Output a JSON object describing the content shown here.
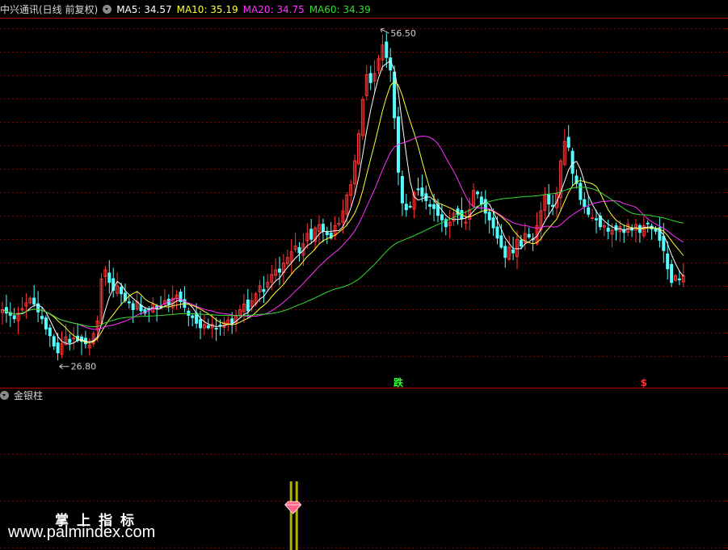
{
  "header": {
    "stock_name": "中兴通讯(日线 前复权)",
    "ma_labels": [
      {
        "text": "MA5: 34.57",
        "color": "#ffffff"
      },
      {
        "text": "MA10: 35.19",
        "color": "#ffff33"
      },
      {
        "text": "MA20: 34.75",
        "color": "#ff33ff"
      },
      {
        "text": "MA60: 34.39",
        "color": "#33dd33"
      }
    ]
  },
  "indicator": {
    "name": "金银柱"
  },
  "colors": {
    "up": "#ff3333",
    "down": "#54ffff",
    "grid": "#7a0000",
    "ma5": "#ffffff",
    "ma10": "#ffff33",
    "ma20": "#ff33ff",
    "ma60": "#33dd33"
  },
  "chart_data": {
    "type": "candlestick",
    "y_range": [
      25.5,
      57.5
    ],
    "max_label": "56.50",
    "min_label": "26.80",
    "max_value": 56.5,
    "min_value": 26.8,
    "signals": [
      {
        "label": "跌",
        "color": "#33ff33",
        "bar": 100
      },
      {
        "label": "$",
        "color": "#ff3333",
        "bar": 162
      }
    ],
    "indicator_bar": {
      "bar": 73,
      "color": "#b0b000"
    },
    "close_series": [
      31.8,
      31.5,
      31.3,
      31.0,
      31.5,
      31.9,
      32.4,
      32.8,
      32.3,
      31.6,
      31.0,
      30.1,
      29.5,
      28.6,
      28.0,
      28.8,
      29.4,
      28.9,
      29.3,
      29.1,
      29.0,
      28.8,
      28.7,
      29.7,
      30.8,
      34.5,
      35.3,
      34.2,
      33.5,
      33.9,
      33.2,
      32.6,
      32.4,
      31.8,
      32.5,
      31.7,
      31.5,
      31.8,
      32.3,
      31.9,
      32.0,
      32.6,
      32.3,
      32.8,
      33.1,
      32.5,
      32.0,
      31.3,
      31.1,
      30.6,
      30.2,
      30.5,
      30.2,
      30.5,
      30.1,
      30.4,
      30.7,
      30.9,
      30.6,
      31.3,
      31.8,
      32.3,
      31.7,
      32.6,
      33.2,
      33.9,
      33.4,
      34.2,
      34.9,
      35.3,
      35.1,
      35.9,
      36.4,
      36.9,
      37.4,
      36.8,
      37.6,
      38.5,
      38.0,
      39.0,
      39.3,
      38.7,
      38.4,
      38.1,
      39.2,
      39.4,
      40.5,
      41.9,
      42.8,
      44.9,
      47.3,
      50.3,
      52.5,
      51.8,
      52.6,
      53.9,
      55.1,
      54.0,
      52.9,
      48.7,
      43.9,
      41.2,
      40.6,
      40.9,
      42.1,
      42.4,
      41.8,
      41.4,
      40.9,
      40.7,
      40.1,
      39.7,
      39.1,
      39.5,
      40.3,
      40.2,
      39.8,
      39.5,
      40.6,
      42.3,
      42.0,
      41.1,
      40.3,
      39.7,
      39.0,
      38.1,
      37.3,
      36.4,
      37.3,
      36.8,
      38.0,
      37.4,
      38.5,
      38.2,
      38.0,
      39.2,
      40.5,
      41.9,
      41.1,
      40.9,
      42.0,
      44.9,
      46.6,
      46.1,
      43.8,
      42.9,
      41.5,
      40.9,
      40.2,
      39.9,
      39.7,
      39.1,
      39.2,
      38.7,
      38.8,
      38.8,
      39.1,
      38.6,
      39.3,
      38.8,
      39.3,
      38.6,
      39.2,
      39.4,
      38.9,
      38.7,
      37.9,
      37.0,
      35.4,
      34.2,
      34.8,
      34.5,
      34.8
    ]
  }
}
